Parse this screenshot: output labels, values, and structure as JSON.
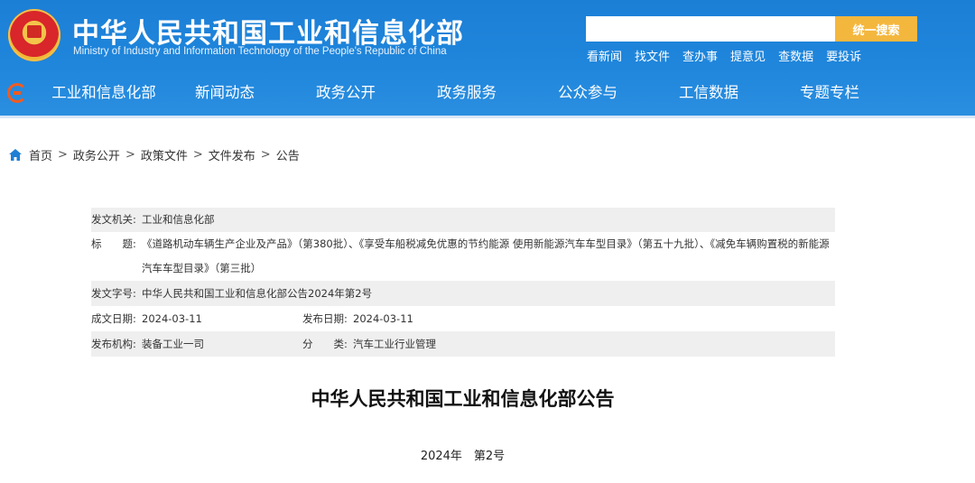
{
  "header": {
    "title_cn": "中华人民共和国工业和信息化部",
    "title_en": "Ministry of Industry and Information Technology of the People's Republic of China",
    "search_placeholder": "",
    "search_button": "统一搜索",
    "quick_links": [
      "看新闻",
      "找文件",
      "查办事",
      "提意见",
      "查数据",
      "要投诉"
    ]
  },
  "nav": {
    "items": [
      "工业和信息化部",
      "新闻动态",
      "政务公开",
      "政务服务",
      "公众参与",
      "工信数据",
      "专题专栏"
    ]
  },
  "breadcrumb": {
    "items": [
      "首页",
      "政务公开",
      "政策文件",
      "文件发布",
      "公告"
    ],
    "separator": ">"
  },
  "meta": {
    "issuer_label": "发文机关:",
    "issuer_value": "工业和信息化部",
    "title_label": "标　　题:",
    "title_value": "《道路机动车辆生产企业及产品》（第380批）、《享受车船税减免优惠的节约能源 使用新能源汽车车型目录》（第五十九批）、《减免车辆购置税的新能源汽车车型目录》（第三批）",
    "docno_label": "发文字号:",
    "docno_value": "中华人民共和国工业和信息化部公告2024年第2号",
    "created_label": "成文日期:",
    "created_value": "2024-03-11",
    "published_label": "发布日期:",
    "published_value": "2024-03-11",
    "org_label": "发布机构:",
    "org_value": "装备工业一司",
    "category_label": "分　　类:",
    "category_value": "汽车工业行业管理"
  },
  "document": {
    "title": "中华人民共和国工业和信息化部公告",
    "number": "2024年　第2号"
  },
  "colors": {
    "header_blue": "#1f86dc",
    "search_button": "#f4b73e",
    "meta_gray_row": "#efefef"
  }
}
